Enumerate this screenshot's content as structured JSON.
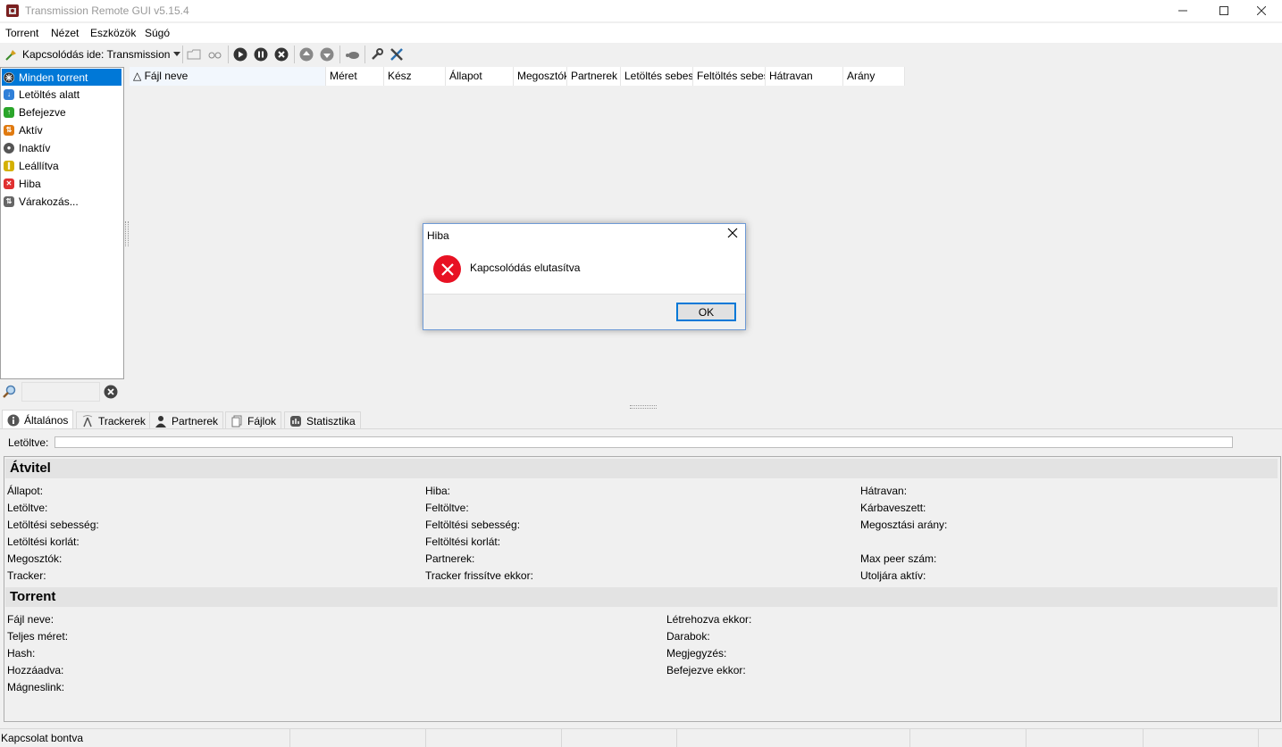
{
  "window": {
    "title": "Transmission Remote GUI v5.15.4"
  },
  "menu": [
    "Torrent",
    "Nézet",
    "Eszközök",
    "Súgó"
  ],
  "toolbar": {
    "connect_label": "Kapcsolódás ide: Transmission"
  },
  "sidebar": {
    "items": [
      {
        "label": "Minden torrent",
        "icon": "all-torrents-icon",
        "color": "#2b2b2b",
        "selected": true
      },
      {
        "label": "Letöltés alatt",
        "icon": "download-icon",
        "color": "#2f7fd8"
      },
      {
        "label": "Befejezve",
        "icon": "completed-icon",
        "color": "#2aa52a"
      },
      {
        "label": "Aktív",
        "icon": "active-icon",
        "color": "#e07a10"
      },
      {
        "label": "Inaktív",
        "icon": "inactive-icon",
        "color": "#555555"
      },
      {
        "label": "Leállítva",
        "icon": "stopped-icon",
        "color": "#d4b000"
      },
      {
        "label": "Hiba",
        "icon": "error-icon",
        "color": "#e03030"
      },
      {
        "label": "Várakozás...",
        "icon": "waiting-icon",
        "color": "#666666"
      }
    ]
  },
  "columns": [
    "△ Fájl neve",
    "Méret",
    "Kész",
    "Állapot",
    "Megosztók",
    "Partnerek",
    "Letöltés sebessége",
    "Feltöltés sebessége",
    "Hátravan",
    "Arány"
  ],
  "tabs": [
    "Általános",
    "Trackerek",
    "Partnerek",
    "Fájlok",
    "Statisztika"
  ],
  "details": {
    "downloaded_label": "Letöltve:",
    "transfer": {
      "title": "Átvitel",
      "col1": [
        "Állapot:",
        "Letöltve:",
        "Letöltési sebesség:",
        "Letöltési korlát:",
        "Megosztók:",
        "Tracker:"
      ],
      "col2": [
        "Hiba:",
        "Feltöltve:",
        "Feltöltési sebesség:",
        "Feltöltési korlát:",
        "Partnerek:",
        "Tracker frissítve ekkor:"
      ],
      "col3": [
        "Hátravan:",
        "Kárbaveszett:",
        "Megosztási arány:",
        "",
        "Max peer szám:",
        "Utoljára aktív:"
      ]
    },
    "torrent": {
      "title": "Torrent",
      "col1": [
        "Fájl neve:",
        "Teljes méret:",
        "Hash:",
        "Hozzáadva:",
        "Mágneslink:"
      ],
      "col2": [
        "Létrehozva ekkor:",
        "Darabok:",
        "Megjegyzés:",
        "Befejezve ekkor:"
      ]
    }
  },
  "statusbar": {
    "text": "Kapcsolat bontva"
  },
  "dialog": {
    "title": "Hiba",
    "message": "Kapcsolódás elutasítva",
    "ok": "OK"
  }
}
